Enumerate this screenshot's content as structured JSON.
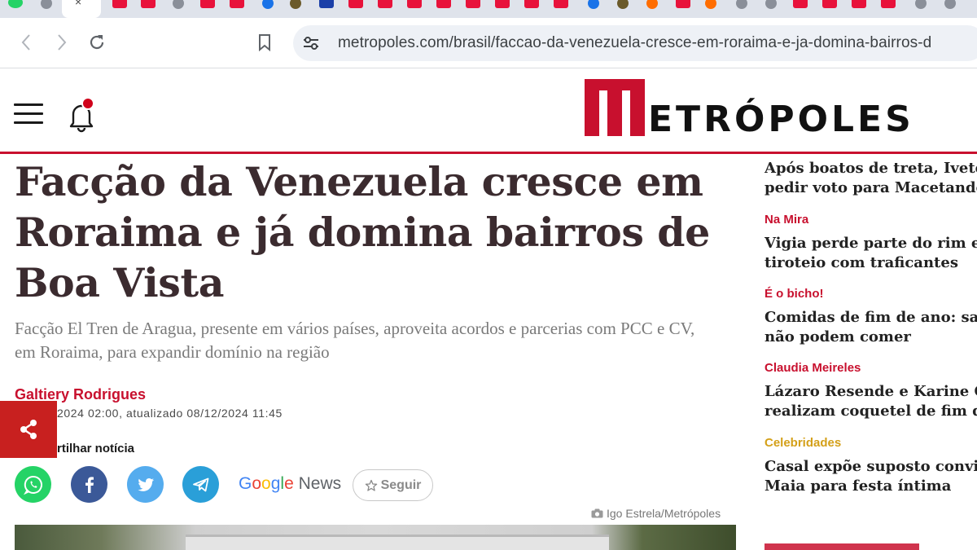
{
  "browser": {
    "url": "metropoles.com/brasil/faccao-da-venezuela-cresce-em-roraima-e-ja-domina-bairros-d"
  },
  "site": {
    "logo_text": "ETRÓPOLES",
    "brand_color": "#c8102e"
  },
  "article": {
    "headline": "Facção da Venezuela cresce em Roraima e já domina bairros de Boa Vista",
    "subtitle": "Facção El Tren de Aragua, presente em vários países, aproveita acordos e parcerias com PCC e CV, em Roraima, para expandir domínio na região",
    "author": "Galtiery Rodrigues",
    "dates": "2024 02:00, atualizado 08/12/2024 11:45",
    "share_label": "rtilhar notícia",
    "google_news_label": "News",
    "follow_label": "Seguir",
    "photo_credit": "Igo Estrela/Metrópoles"
  },
  "share_buttons": [
    {
      "icon": "whatsapp-icon",
      "color": "#25d366"
    },
    {
      "icon": "facebook-icon",
      "color": "#3b5998"
    },
    {
      "icon": "twitter-icon",
      "color": "#55acee"
    },
    {
      "icon": "telegram-icon",
      "color": "#2a9fd8"
    }
  ],
  "sidebar": {
    "items": [
      {
        "category": "",
        "title_line1": "Após boatos de treta, Ivete",
        "title_line2": "pedir voto para Macetando"
      },
      {
        "category": "Na Mira",
        "title_line1": "Vigia perde parte do rim e d",
        "title_line2": "tiroteio com traficantes"
      },
      {
        "category": "É o bicho!",
        "title_line1": "Comidas de fim de ano: sai",
        "title_line2": "não podem comer"
      },
      {
        "category": "Claudia Meireles",
        "title_line1": "Lázaro Resende e Karine Ca",
        "title_line2": "realizam coquetel de fim de"
      },
      {
        "category": "Celebridades",
        "title_line1": "Casal expõe suposto convit",
        "title_line2": "Maia para festa íntima"
      }
    ]
  }
}
